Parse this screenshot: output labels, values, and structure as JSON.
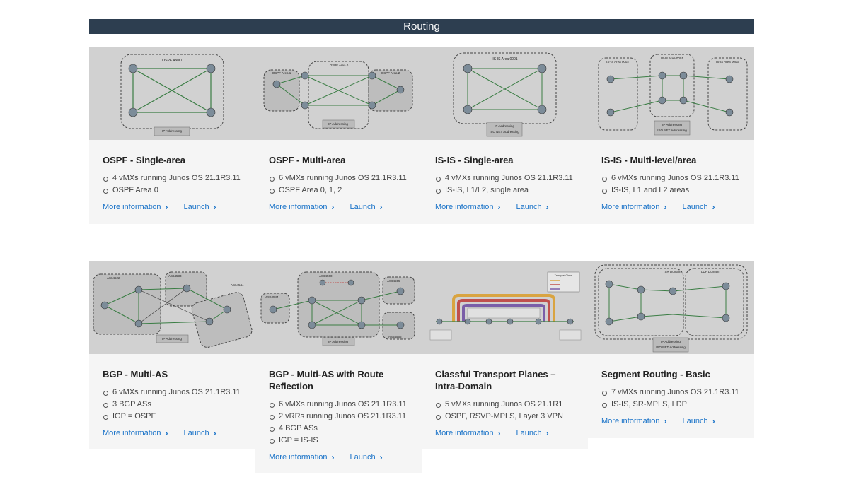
{
  "header": {
    "title": "Routing"
  },
  "colors": {
    "header_bg": "#2d3e50",
    "link": "#1a73c8",
    "thumb_bg": "#d1d1d1"
  },
  "cards": [
    {
      "title": "OSPF - Single-area",
      "items": [
        "4 vMXs running Junos OS 21.1R3.11",
        "OSPF Area 0"
      ],
      "more": "More information",
      "launch": "Launch",
      "thumb_labels": [
        "OSPF Area 0",
        "IP Addressing"
      ]
    },
    {
      "title": "OSPF - Multi-area",
      "items": [
        "6 vMXs running Junos OS 21.1R3.11",
        "OSPF Area 0, 1, 2"
      ],
      "more": "More information",
      "launch": "Launch",
      "thumb_labels": [
        "OSPF Area 1",
        "OSPF Area 0",
        "OSPF Area 2",
        "IP Addressing"
      ]
    },
    {
      "title": "IS-IS - Single-area",
      "items": [
        "4 vMXs running Junos OS 21.1R3.11",
        "IS-IS, L1/L2, single area"
      ],
      "more": "More information",
      "launch": "Launch",
      "thumb_labels": [
        "IS-IS Area 0001",
        "IP Addressing",
        "ISO NET Addressing"
      ]
    },
    {
      "title": "IS-IS - Multi-level/area",
      "items": [
        "6 vMXs running Junos OS 21.1R3.11",
        "IS-IS, L1 and L2 areas"
      ],
      "more": "More information",
      "launch": "Launch",
      "thumb_labels": [
        "IS-IS Area 0002",
        "IS-IS Area 0001",
        "IS-IS Area 0003",
        "IP Addressing",
        "ISO NET Addressing"
      ]
    },
    {
      "title": "BGP - Multi-AS",
      "items": [
        "6 vMXs running Junos OS 21.1R3.11",
        "3 BGP ASs",
        "IGP = OSPF"
      ],
      "more": "More information",
      "launch": "Launch",
      "thumb_labels": [
        "AS64522",
        "AS64533",
        "AS64544",
        "IP Addressing"
      ]
    },
    {
      "title": "BGP - Multi-AS with Route Reflection",
      "items": [
        "6 vMXs running Junos OS 21.1R3.11",
        "2 vRRs running Junos OS 21.1R3.11",
        "4 BGP ASs",
        "IGP = IS-IS"
      ],
      "more": "More information",
      "launch": "Launch",
      "thumb_labels": [
        "AS64544",
        "AS64500",
        "AS64555",
        "AS64566",
        "IP Addressing"
      ]
    },
    {
      "title": "Classful Transport Planes – Intra-Domain",
      "items": [
        "5 vMXs running Junos OS 21.1R1",
        "OSPF, RSVP-MPLS, Layer 3 VPN"
      ],
      "more": "More information",
      "launch": "Launch",
      "thumb_labels": [
        "Transport Class"
      ]
    },
    {
      "title": "Segment Routing - Basic",
      "items": [
        "7 vMXs running Junos OS 21.1R3.11",
        "IS-IS, SR-MPLS, LDP"
      ],
      "more": "More information",
      "launch": "Launch",
      "thumb_labels": [
        "SR Domain",
        "LDP Domain",
        "IP Addressing",
        "ISO NET Addressing"
      ]
    }
  ]
}
